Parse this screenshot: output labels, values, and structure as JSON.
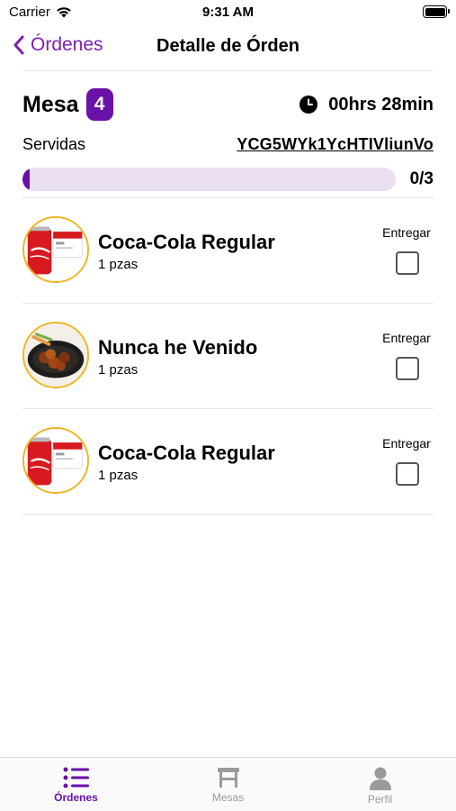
{
  "status_bar": {
    "carrier": "Carrier",
    "time": "9:31 AM"
  },
  "nav": {
    "back_label": "Órdenes",
    "title": "Detalle de Órden"
  },
  "order": {
    "mesa_label": "Mesa",
    "mesa_number": "4",
    "elapsed": "00hrs 28min",
    "served_label": "Servidas",
    "code": "YCG5WYk1YcHTIVliunVo",
    "progress_text": "0/3",
    "progress_fraction": 0
  },
  "items": [
    {
      "name": "Coca-Cola Regular",
      "qty": "1 pzas",
      "deliver_label": "Entregar",
      "delivered": false,
      "image": "coca-cola-can"
    },
    {
      "name": "Nunca he Venido",
      "qty": "1 pzas",
      "deliver_label": "Entregar",
      "delivered": false,
      "image": "boneless-wings-plate"
    },
    {
      "name": "Coca-Cola Regular",
      "qty": "1 pzas",
      "deliver_label": "Entregar",
      "delivered": false,
      "image": "coca-cola-can"
    }
  ],
  "tabs": [
    {
      "label": "Órdenes",
      "icon": "list-icon",
      "active": true
    },
    {
      "label": "Mesas",
      "icon": "table-icon",
      "active": false
    },
    {
      "label": "Perfil",
      "icon": "person-icon",
      "active": false
    }
  ],
  "colors": {
    "accent": "#6a11a8",
    "back": "#7c1fb3",
    "thumb_border": "#f0b623",
    "progress_track": "#eadff2"
  }
}
